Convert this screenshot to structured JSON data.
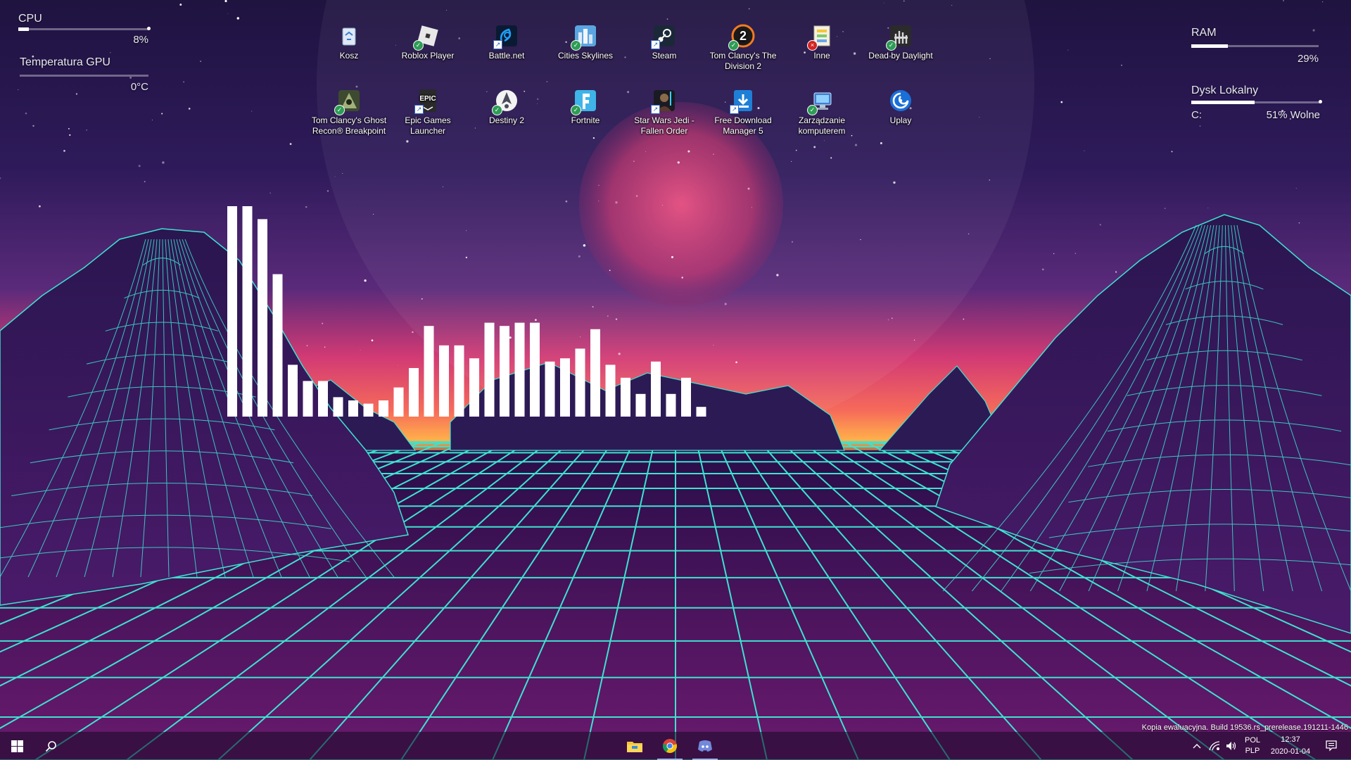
{
  "widgets": {
    "cpu": {
      "label": "CPU",
      "value": "8%",
      "fraction": 0.08
    },
    "gpu_temp": {
      "label": "Temperatura GPU",
      "value": "0°C",
      "fraction": 0.0
    },
    "ram": {
      "label": "RAM",
      "value": "29%",
      "fraction": 0.29
    },
    "disk": {
      "label": "Dysk Lokalny",
      "drive": "C:",
      "value": "51% Wolne",
      "fraction": 0.49
    }
  },
  "desktop_icons": [
    {
      "label": "Kosz",
      "icon": "recycle-bin-icon"
    },
    {
      "label": "Roblox Player",
      "icon": "roblox-icon"
    },
    {
      "label": "Battle.net",
      "icon": "battlenet-icon"
    },
    {
      "label": "Cities Skylines",
      "icon": "cities-skylines-icon"
    },
    {
      "label": "Steam",
      "icon": "steam-icon"
    },
    {
      "label": "Tom Clancy's The Division 2",
      "icon": "division-2-icon"
    },
    {
      "label": "Inne",
      "icon": "folder-icon"
    },
    {
      "label": "Dead by Daylight",
      "icon": "dead-by-daylight-icon"
    },
    {
      "label": "Tom Clancy's Ghost Recon® Breakpoint",
      "icon": "ghost-recon-icon"
    },
    {
      "label": "Epic Games Launcher",
      "icon": "epic-games-icon",
      "logo_text": "EPIC"
    },
    {
      "label": "Destiny 2",
      "icon": "destiny-2-icon"
    },
    {
      "label": "Fortnite",
      "icon": "fortnite-icon"
    },
    {
      "label": "Star Wars Jedi - Fallen Order",
      "icon": "star-wars-jedi-icon"
    },
    {
      "label": "Free Download Manager 5",
      "icon": "free-download-manager-icon"
    },
    {
      "label": "Zarządzanie komputerem",
      "icon": "computer-management-icon"
    },
    {
      "label": "Uplay",
      "icon": "uplay-icon"
    }
  ],
  "visualizer_levels": [
    0.65,
    0.65,
    0.61,
    0.44,
    0.16,
    0.11,
    0.11,
    0.06,
    0.05,
    0.04,
    0.05,
    0.09,
    0.15,
    0.28,
    0.22,
    0.22,
    0.18,
    0.29,
    0.28,
    0.29,
    0.29,
    0.17,
    0.18,
    0.21,
    0.27,
    0.16,
    0.12,
    0.07,
    0.17,
    0.07,
    0.12,
    0.03
  ],
  "watermark": "Kopia ewaluacyjna. Build 19536.rs_prerelease.191211-1446",
  "taskbar": {
    "apps": [
      "file-explorer-icon",
      "chrome-icon",
      "discord-icon"
    ],
    "language_primary": "POL",
    "language_secondary": "PLP",
    "time": "12:37",
    "date": "2020-01-04"
  },
  "colors": {
    "grid": "#3ce3cf",
    "sky_top": "#271446",
    "sky_glow": "#f2436f",
    "floor": "#3b0f5a"
  }
}
